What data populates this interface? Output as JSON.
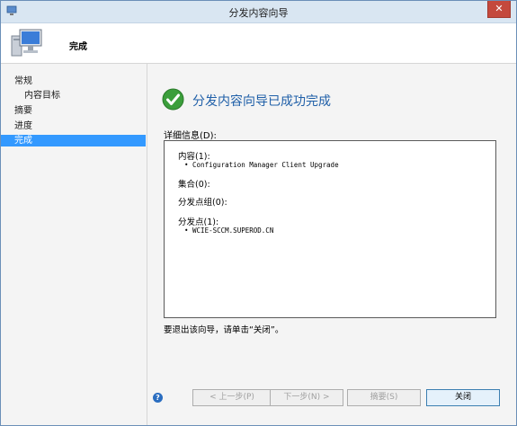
{
  "window": {
    "title": "分发内容向导",
    "close_glyph": "✕"
  },
  "header": {
    "title": "完成"
  },
  "sidebar": {
    "items": [
      {
        "label": "常规"
      },
      {
        "label": "内容目标"
      },
      {
        "label": "摘要"
      },
      {
        "label": "进度"
      },
      {
        "label": "完成"
      }
    ],
    "active_index": 4
  },
  "main": {
    "status": "分发内容向导已成功完成",
    "details_label": "详细信息(D):",
    "details": {
      "content_title": "内容(1):",
      "content_item": "Configuration Manager Client Upgrade",
      "collections_title": "集合(0):",
      "dp_groups_title": "分发点组(0):",
      "dps_title": "分发点(1):",
      "dp_item": "WCIE-SCCM.SUPEROD.CN"
    },
    "exit_hint": "要退出该向导，请单击“关闭”。"
  },
  "buttons": {
    "prev": "< 上一步(P)",
    "next": "下一步(N) >",
    "summary": "摘要(S)",
    "close": "关闭"
  },
  "help_glyph": "?",
  "colors": {
    "accent": "#3399ff",
    "status_text": "#1f5fa8",
    "success": "#3b9e3b",
    "close_button": "#c4493d"
  }
}
